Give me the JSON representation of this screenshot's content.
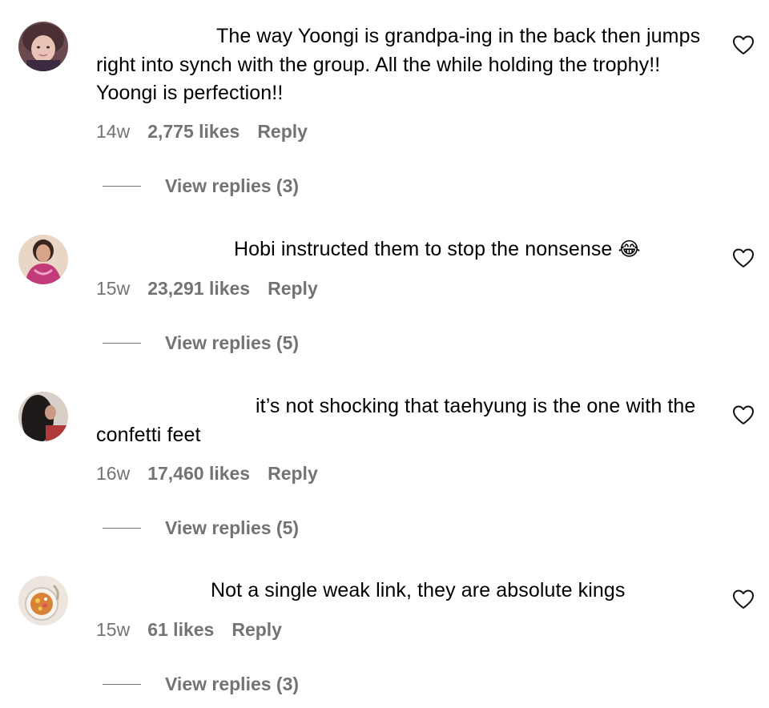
{
  "comments": [
    {
      "username": "",
      "text": "The way Yoongi is grandpa-ing in the back then jumps right into synch with the group. All the while holding the trophy!! Yoongi is perfection!!",
      "time": "14w",
      "likes": "2,775 likes",
      "reply_label": "Reply",
      "view_replies_label": "View replies (3)",
      "like_icon": "heart-outline-icon"
    },
    {
      "username": "",
      "text": "Hobi instructed them to stop the nonsense",
      "emoji": "😂",
      "time": "15w",
      "likes": "23,291 likes",
      "reply_label": "Reply",
      "view_replies_label": "View replies (5)",
      "like_icon": "heart-outline-icon"
    },
    {
      "username": "",
      "text": "it’s not shocking that taehyung is the one with the confetti feet",
      "time": "16w",
      "likes": "17,460 likes",
      "reply_label": "Reply",
      "view_replies_label": "View replies (5)",
      "like_icon": "heart-outline-icon"
    },
    {
      "username": "",
      "text": "Not a single weak link, they are absolute kings",
      "time": "15w",
      "likes": "61 likes",
      "reply_label": "Reply",
      "view_replies_label": "View replies (3)",
      "like_icon": "heart-outline-icon"
    }
  ],
  "colors": {
    "text": "#000000",
    "secondary_text": "#737373",
    "background": "#ffffff"
  }
}
